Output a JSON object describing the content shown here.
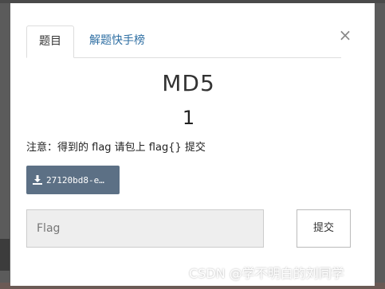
{
  "modal": {
    "tabs": [
      {
        "label": "题目",
        "active": true
      },
      {
        "label": "解题快手榜",
        "active": false
      }
    ],
    "close_glyph": "×",
    "challenge_title": "MD5",
    "points": "1",
    "notice": "注意：得到的 flag 请包上 flag{} 提交",
    "download_label": "27120bd8-e…",
    "flag_placeholder": "Flag",
    "submit_label": "提交"
  },
  "watermark": "CSDN @学不明白的刘同学",
  "colors": {
    "tab_link": "#2f6fa3",
    "download_button": "#5c7085",
    "input_bg": "#eeeeee"
  }
}
